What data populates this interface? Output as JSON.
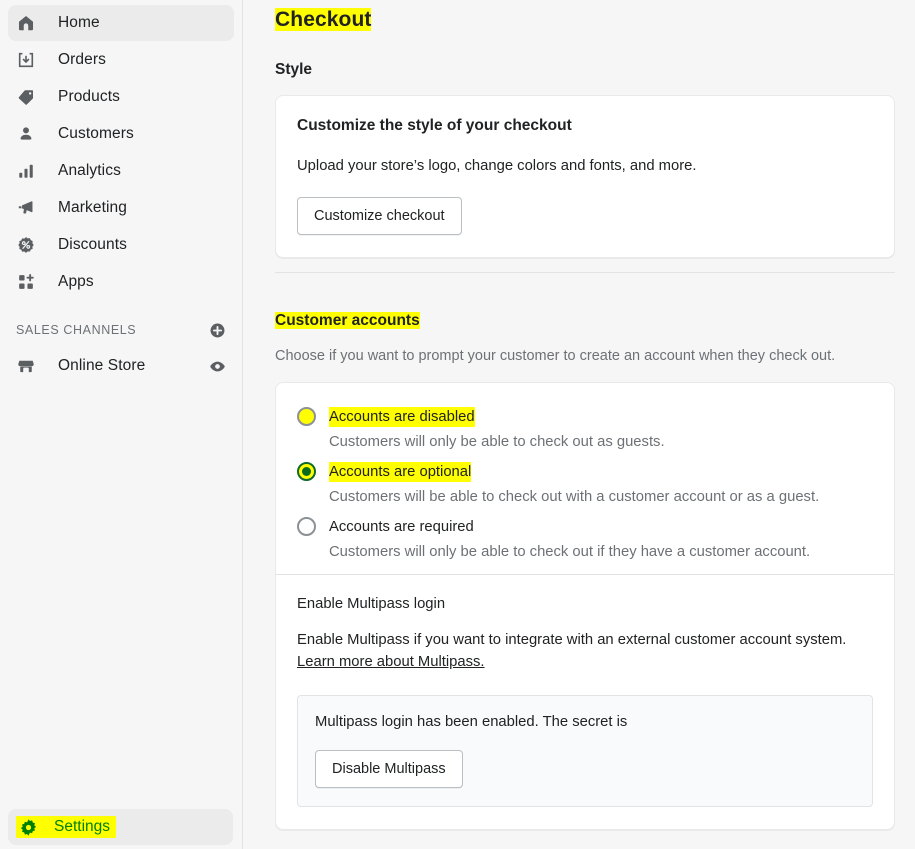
{
  "sidebar": {
    "nav_items": [
      {
        "label": "Home",
        "icon": "home-icon",
        "active": true
      },
      {
        "label": "Orders",
        "icon": "orders-icon",
        "active": false
      },
      {
        "label": "Products",
        "icon": "products-tag-icon",
        "active": false
      },
      {
        "label": "Customers",
        "icon": "customers-person-icon",
        "active": false
      },
      {
        "label": "Analytics",
        "icon": "analytics-bars-icon",
        "active": false
      },
      {
        "label": "Marketing",
        "icon": "marketing-megaphone-icon",
        "active": false
      },
      {
        "label": "Discounts",
        "icon": "discounts-percent-icon",
        "active": false
      },
      {
        "label": "Apps",
        "icon": "apps-grid-plus-icon",
        "active": false
      }
    ],
    "sales_channels": {
      "title": "SALES CHANNELS",
      "add_icon": "plus-circle-icon",
      "items": [
        {
          "label": "Online Store",
          "icon": "online-store-icon",
          "trailing_icon": "eye-icon"
        }
      ]
    },
    "settings": {
      "label": "Settings",
      "icon": "gear-icon",
      "highlight_color": "#ffff00",
      "text_color": "#008000"
    }
  },
  "main": {
    "page_title": "Checkout",
    "style_section": {
      "heading": "Style",
      "card": {
        "title": "Customize the style of your checkout",
        "text": "Upload your store’s logo, change colors and fonts, and more.",
        "button_label": "Customize checkout"
      }
    },
    "customer_accounts_section": {
      "heading": "Customer accounts",
      "description": "Choose if you want to prompt your customer to create an account when they check out.",
      "options": [
        {
          "label": "Accounts are disabled",
          "help": "Customers will only be able to check out as guests.",
          "selected": false,
          "highlighted": true
        },
        {
          "label": "Accounts are optional",
          "help": "Customers will be able to check out with a customer account or as a guest.",
          "selected": true,
          "highlighted": true
        },
        {
          "label": "Accounts are required",
          "help": "Customers will only be able to check out if they have a customer account.",
          "selected": false,
          "highlighted": false
        }
      ],
      "multipass": {
        "title": "Enable Multipass login",
        "text": "Enable Multipass if you want to integrate with an external customer account system.",
        "link_label": "Learn more about Multipass.",
        "status_box": {
          "text": "Multipass login has been enabled. The secret is",
          "button_label": "Disable Multipass"
        }
      }
    }
  },
  "colors": {
    "highlight": "#ffff00",
    "selected_green": "#0a6b1f",
    "sidebar_bg": "#f6f6f7",
    "card_bg": "#ffffff",
    "page_bg": "#f6f6f7"
  }
}
